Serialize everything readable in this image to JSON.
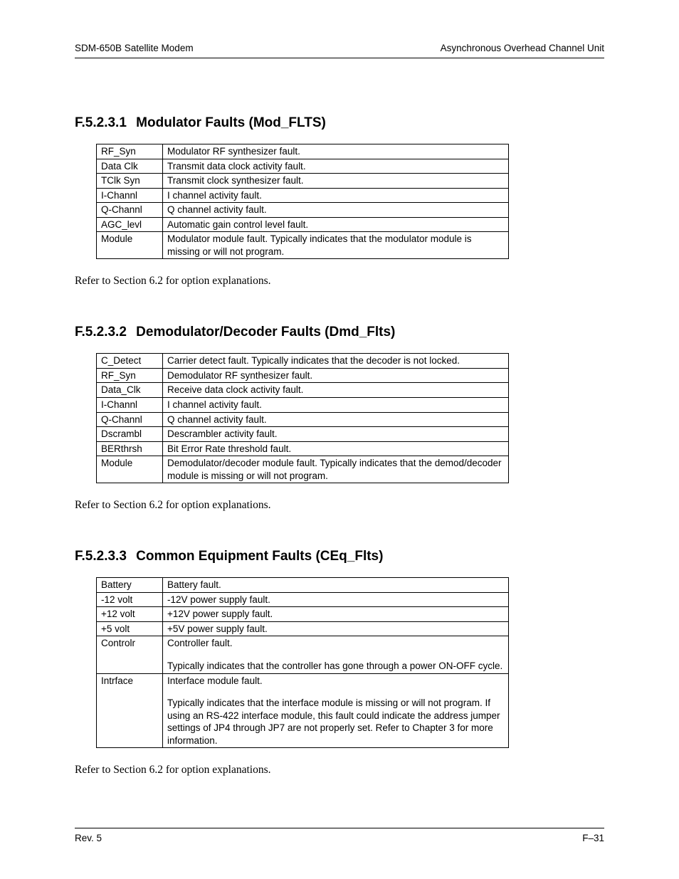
{
  "header": {
    "left": "SDM-650B Satellite Modem",
    "right": "Asynchronous Overhead Channel Unit"
  },
  "sections": [
    {
      "num": "F.5.2.3.1",
      "title": "Modulator Faults (Mod_FLTS)",
      "rows": [
        {
          "key": "RF_Syn",
          "val": "Modulator RF synthesizer fault."
        },
        {
          "key": "Data Clk",
          "val": "Transmit data clock activity fault."
        },
        {
          "key": "TClk Syn",
          "val": "Transmit clock synthesizer fault."
        },
        {
          "key": "I-Channl",
          "val": "I channel activity fault."
        },
        {
          "key": "Q-Channl",
          "val": "Q channel activity fault."
        },
        {
          "key": "AGC_levl",
          "val": "Automatic gain control level fault."
        },
        {
          "key": "Module",
          "val": "Modulator module fault. Typically indicates that the modulator module is missing or will not program."
        }
      ],
      "refer": "Refer to Section 6.2 for option explanations."
    },
    {
      "num": "F.5.2.3.2",
      "title": "Demodulator/Decoder Faults (Dmd_Flts)",
      "rows": [
        {
          "key": "C_Detect",
          "val": "Carrier detect fault. Typically indicates that the decoder is not locked."
        },
        {
          "key": "RF_Syn",
          "val": "Demodulator RF synthesizer fault."
        },
        {
          "key": "Data_Clk",
          "val": "Receive data clock activity fault."
        },
        {
          "key": "I-Channl",
          "val": "I channel activity fault."
        },
        {
          "key": "Q-Channl",
          "val": "Q channel activity fault."
        },
        {
          "key": "Dscrambl",
          "val": "Descrambler activity fault."
        },
        {
          "key": "BERthrsh",
          "val": "Bit Error Rate threshold fault."
        },
        {
          "key": "Module",
          "val": "Demodulator/decoder module fault. Typically indicates that the demod/decoder module is missing or will not program."
        }
      ],
      "refer": "Refer to Section 6.2 for option explanations."
    },
    {
      "num": "F.5.2.3.3",
      "title": "Common Equipment Faults (CEq_Flts)",
      "rows": [
        {
          "key": "Battery",
          "val": "Battery fault."
        },
        {
          "key": "-12 volt",
          "val": "-12V power supply fault."
        },
        {
          "key": "+12 volt",
          "val": "+12V power supply fault."
        },
        {
          "key": "+5 volt",
          "val": "+5V power supply fault."
        },
        {
          "key": "Controlr",
          "paras": [
            "Controller fault.",
            "Typically indicates that the controller has gone through a power ON-OFF cycle."
          ]
        },
        {
          "key": "Intrface",
          "paras": [
            "Interface module fault.",
            "Typically indicates that the interface module is missing or will not program. If using an RS-422 interface module, this fault could indicate the address jumper settings of JP4 through JP7 are not properly set. Refer to Chapter 3 for more information."
          ]
        }
      ],
      "refer": "Refer to Section 6.2 for option explanations."
    }
  ],
  "footer": {
    "left": "Rev. 5",
    "right": "F–31"
  }
}
